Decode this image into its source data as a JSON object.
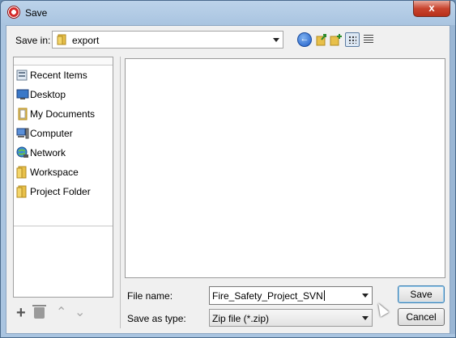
{
  "window": {
    "title": "Save",
    "close_glyph": "x"
  },
  "save_in": {
    "label": "Save in:",
    "value": "export"
  },
  "toolbar": {
    "back_glyph": "←",
    "icons": [
      "back-icon",
      "up-folder-icon",
      "new-folder-icon",
      "list-view-icon",
      "details-view-icon"
    ]
  },
  "places": {
    "items": [
      {
        "label": "Recent Items",
        "icon": "recent-items-icon"
      },
      {
        "label": "Desktop",
        "icon": "desktop-icon"
      },
      {
        "label": "My Documents",
        "icon": "documents-icon"
      },
      {
        "label": "Computer",
        "icon": "computer-icon"
      },
      {
        "label": "Network",
        "icon": "network-icon"
      },
      {
        "label": "Workspace",
        "icon": "folder-icon"
      },
      {
        "label": "Project Folder",
        "icon": "folder-icon"
      }
    ],
    "tools": {
      "add_glyph": "+",
      "up_glyph": "⌃",
      "down_glyph": "⌄"
    }
  },
  "file_name": {
    "label": "File name:",
    "value": "Fire_Safety_Project_SVN"
  },
  "save_as_type": {
    "label": "Save as type:",
    "value": "Zip file (*.zip)"
  },
  "buttons": {
    "save": "Save",
    "cancel": "Cancel"
  },
  "colors": {
    "title_bar": "#bcd3ea",
    "close_button": "#c8442e",
    "accent": "#3c7fb1"
  }
}
